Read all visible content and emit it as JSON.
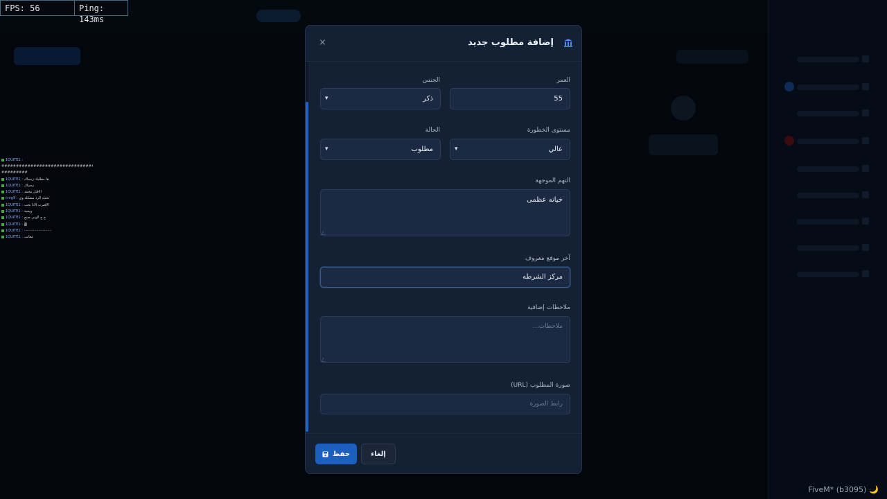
{
  "perf": {
    "fps": "FPS: 56",
    "ping": "Ping: 143ms"
  },
  "modal": {
    "title": "إضافة مطلوب جديد",
    "close": "×",
    "age": {
      "label": "العمر",
      "value": "55"
    },
    "gender": {
      "label": "الجنس",
      "value": "ذكر"
    },
    "danger": {
      "label": "مستوى الخطورة",
      "value": "عالي"
    },
    "status": {
      "label": "الحالة",
      "value": "مطلوب"
    },
    "charges": {
      "label": "التهم الموجهة",
      "value": "خيانه عظمى"
    },
    "location": {
      "label": "آخر موقع معروف",
      "value": "مركز الشرطه"
    },
    "notes": {
      "label": "ملاحظات إضافية",
      "placeholder": "ملاحظات..."
    },
    "photo": {
      "label": "صورة المطلوب (URL)",
      "placeholder": "رابط الصورة"
    },
    "buttons": {
      "save": "حفظ",
      "cancel": "إلغاء"
    }
  },
  "chat": [
    {
      "name": "1QUITE1 :",
      "msg": ""
    },
    {
      "name": "",
      "msg": "###########################################"
    },
    {
      "name": "",
      "msg": "#########"
    },
    {
      "name": "1QUITE1 :",
      "msg": "ها مطليك زحماك"
    },
    {
      "name": "1QUITE1 :",
      "msg": "زحماك"
    },
    {
      "name": "1QUITE1 :",
      "msg": "الاقتل محمد"
    },
    {
      "name": "crvg9 :",
      "msg": "تحتية الرد مشكلة وي"
    },
    {
      "name": "1QUITE1 :",
      "msg": "الاضرب الانا بحب"
    },
    {
      "name": "1QUITE1 :",
      "msg": "ويجية"
    },
    {
      "name": "1QUITE1 :",
      "msg": "ج ج الوني صبح"
    },
    {
      "name": "1QUITE1 :",
      "msg": "▒"
    },
    {
      "name": "1QUITE1 :",
      "msg": "·························"
    },
    {
      "name": "1QUITE1 :",
      "msg": "معانب"
    }
  ],
  "footer": {
    "client": "FiveM* (b3095)",
    "moon": "🌙"
  },
  "colors": {
    "accent": "#1d5fbf",
    "modal_bg": "#142033",
    "field_bg": "#1b2a42"
  }
}
